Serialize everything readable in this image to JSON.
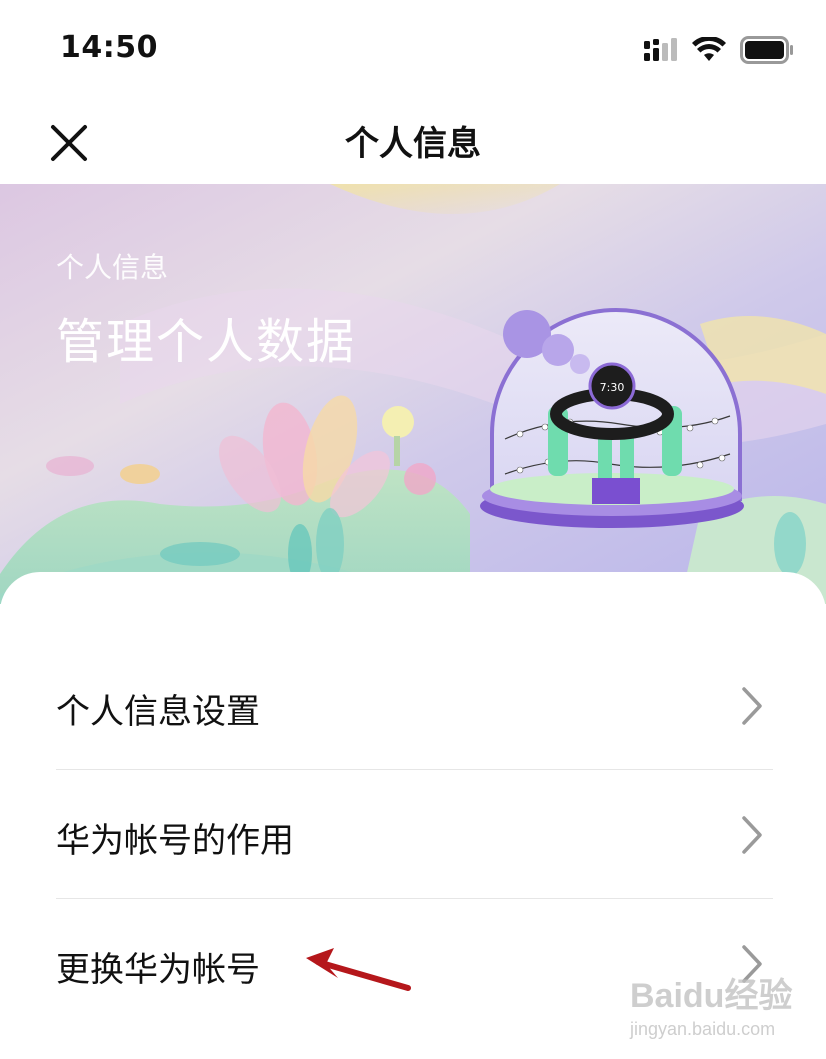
{
  "status_bar": {
    "time": "14:50",
    "icons": [
      "signal-icon",
      "wifi-icon",
      "battery-icon"
    ]
  },
  "nav": {
    "title": "个人信息",
    "close_icon": "close-icon"
  },
  "banner": {
    "subtitle": "个人信息",
    "title": "管理个人数据",
    "watch_time": "7:30"
  },
  "menu": {
    "items": [
      {
        "label": "个人信息设置",
        "icon": "chevron-right-icon"
      },
      {
        "label": "华为帐号的作用",
        "icon": "chevron-right-icon"
      },
      {
        "label": "更换华为帐号",
        "icon": "chevron-right-icon"
      }
    ]
  },
  "annotation": {
    "icon": "red-arrow-icon",
    "color": "#b5171b"
  },
  "watermark": {
    "main": "Baidu经验",
    "sub": "jingyan.baidu.com"
  }
}
